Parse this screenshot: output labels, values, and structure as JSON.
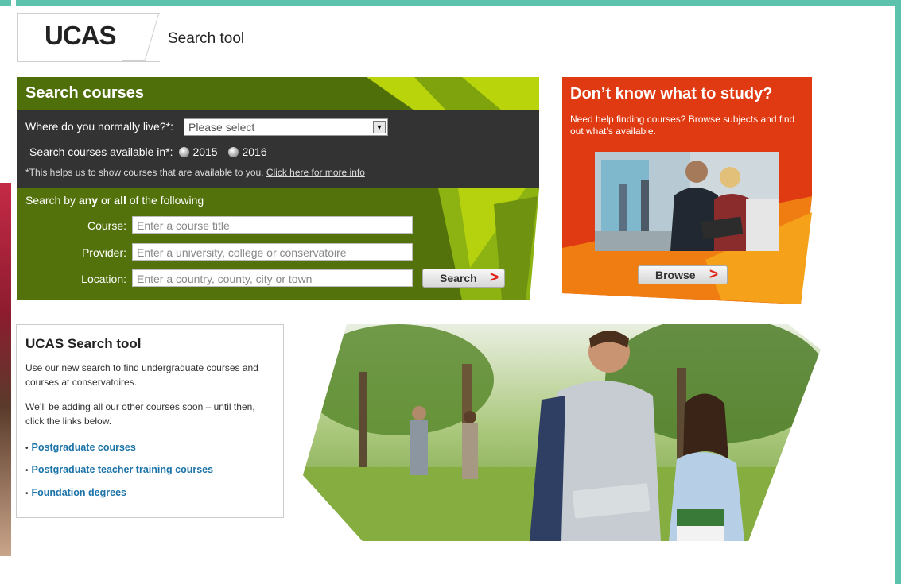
{
  "header": {
    "logo": "UCAS",
    "title": "Search tool"
  },
  "search": {
    "heading": "Search courses",
    "live_label": "Where do you normally live?*:",
    "live_select_value": "Please select",
    "year_label": "Search courses available in*:",
    "years": [
      "2015",
      "2016"
    ],
    "note": "*This helps us to show courses that are available to you.",
    "note_link": "Click here for more info",
    "filter_intro_prefix": "Search by ",
    "filter_intro_any": "any",
    "filter_intro_or": " or ",
    "filter_intro_all": "all",
    "filter_intro_suffix": " of the following",
    "course_label": "Course:",
    "course_placeholder": "Enter a course title",
    "provider_label": "Provider:",
    "provider_placeholder": "Enter a university, college or conservatoire",
    "location_label": "Location:",
    "location_placeholder": "Enter a country, county, city or town",
    "button_label": "Search",
    "button_chevron": ">"
  },
  "promo": {
    "title": "Don’t know what to study?",
    "description": "Need help finding courses? Browse subjects and find out what’s available.",
    "button_label": "Browse",
    "button_chevron": ">"
  },
  "info": {
    "title": "UCAS Search tool",
    "p1": "Use our new search to find undergraduate courses and courses at conservatoires.",
    "p2": "We’ll be adding all our other courses soon – until then, click the links below.",
    "links": [
      "Postgraduate courses",
      "Postgraduate teacher training courses",
      "Foundation degrees"
    ]
  },
  "colors": {
    "teal_strip": "#5cc1ad",
    "search_green": "#5a7a0e",
    "search_dark": "#333333",
    "promo_red": "#e03a12",
    "promo_orange": "#f08c10",
    "link_blue": "#1b73a8",
    "chevron_red": "#e2231a"
  }
}
